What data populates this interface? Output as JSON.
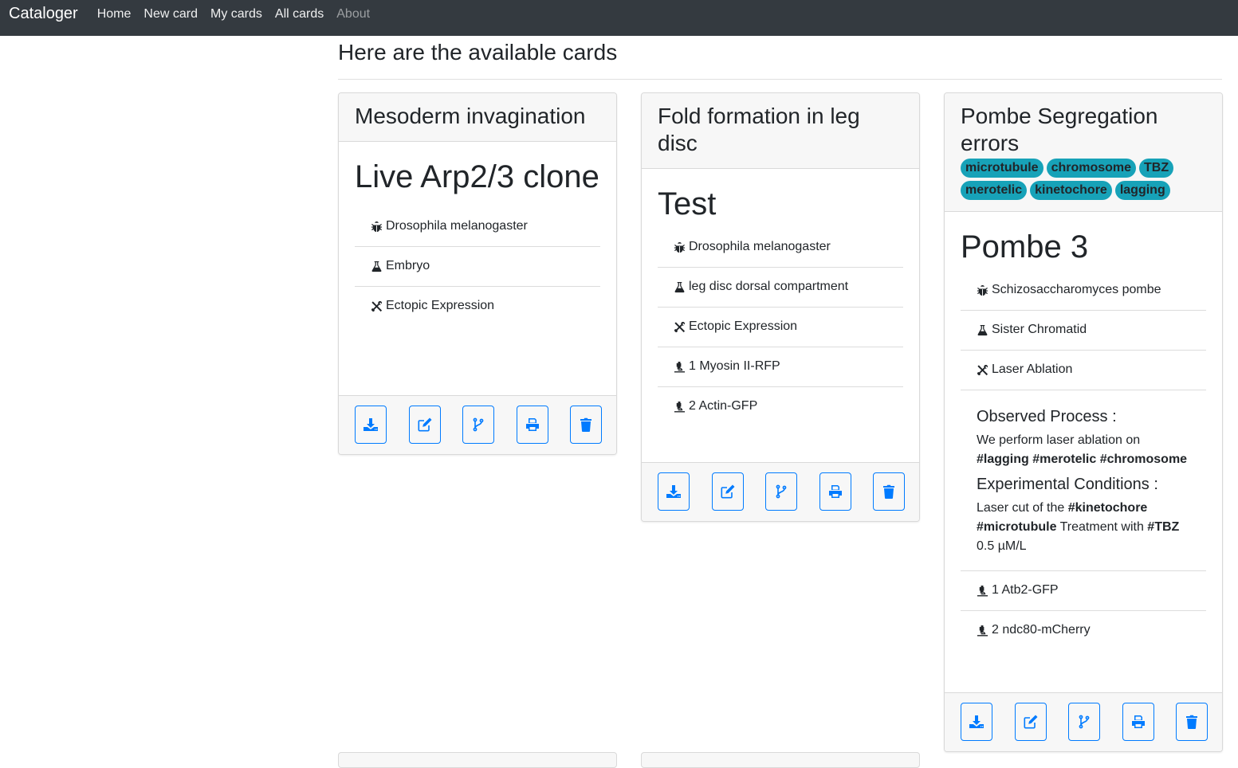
{
  "nav": {
    "brand": "Cataloger",
    "links": [
      {
        "label": "Home"
      },
      {
        "label": "New card"
      },
      {
        "label": "My cards"
      },
      {
        "label": "All cards"
      },
      {
        "label": "About"
      }
    ]
  },
  "page": {
    "title": "Here are the available cards"
  },
  "colors": {
    "accent": "#007bff",
    "tag_bg": "#17a2b8",
    "navbar_bg": "#343a40"
  },
  "cards": [
    {
      "title": "Mesoderm invagination",
      "tags": [],
      "subtitle": "Live Arp2/3 clone",
      "organism": "Drosophila melanogaster",
      "sample": "Embryo",
      "method": "Ectopic Expression"
    },
    {
      "title": "Fold formation in leg disc",
      "tags": [],
      "subtitle": "Test",
      "organism": "Drosophila melanogaster",
      "sample": "leg disc dorsal compartment",
      "method": "Ectopic Expression",
      "channels": [
        "1 Myosin II-RFP",
        "2 Actin-GFP"
      ]
    },
    {
      "title": "Pombe Segregation errors",
      "tags": [
        "microtubule",
        "chromosome",
        "TBZ",
        "merotelic",
        "kinetochore",
        "lagging"
      ],
      "subtitle": "Pombe 3",
      "organism": "Schizosaccharomyces pombe",
      "sample": "Sister Chromatid",
      "method": "Laser Ablation",
      "observed_label": "Observed Process :",
      "observed_text": "We perform laser ablation on",
      "observed_tags": "#lagging #merotelic #chromosome",
      "conditions_label": "Experimental Conditions :",
      "conditions_1": "Laser cut of the ",
      "conditions_tag1": "#kinetochore",
      "conditions_tag2": "#microtubule",
      "conditions_2": " Treatment with ",
      "conditions_tag3": "#TBZ",
      "conditions_3": "0.5 µM/L",
      "channels": [
        "1 Atb2-GFP",
        "2 ndc80-mCherry"
      ]
    }
  ],
  "card_actions": [
    {
      "icon": "download-icon",
      "label": "Download"
    },
    {
      "icon": "edit-icon",
      "label": "Edit"
    },
    {
      "icon": "fork-icon",
      "label": "Fork"
    },
    {
      "icon": "print-icon",
      "label": "Print"
    },
    {
      "icon": "trash-icon",
      "label": "Delete"
    }
  ]
}
